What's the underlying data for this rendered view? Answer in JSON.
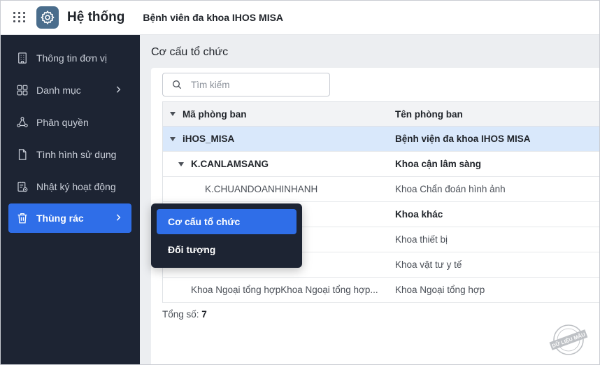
{
  "header": {
    "app_title": "Hệ thống",
    "org_name": "Bệnh viên đa khoa IHOS MISA"
  },
  "sidebar": {
    "items": [
      {
        "label": "Thông tin đơn vị",
        "icon": "building-icon"
      },
      {
        "label": "Danh mục",
        "icon": "category-grid-icon",
        "has_submenu": true
      },
      {
        "label": "Phân quyền",
        "icon": "permission-nodes-icon"
      },
      {
        "label": "Tình hình sử dụng",
        "icon": "document-icon"
      },
      {
        "label": "Nhật ký hoạt động",
        "icon": "activity-log-icon"
      },
      {
        "label": "Thùng rác",
        "icon": "trash-icon",
        "has_submenu": true,
        "active": true
      }
    ]
  },
  "main": {
    "page_title": "Cơ cấu tổ chức",
    "search": {
      "placeholder": "Tìm kiếm",
      "value": ""
    },
    "table": {
      "columns": [
        "Mã phòng ban",
        "Tên phòng ban"
      ],
      "rows": [
        {
          "code": "iHOS_MISA",
          "name": "Bệnh viện đa khoa IHOS MISA",
          "level": 0,
          "expanded": true,
          "bold": true,
          "selected": true
        },
        {
          "code": "K.CANLAMSANG",
          "name": "Khoa cận lâm sàng",
          "level": 1,
          "expanded": true,
          "bold": true
        },
        {
          "code": "K.CHUANDOANHINHANH",
          "name": "Khoa Chẩn đoán hình ảnh",
          "level": 2
        },
        {
          "code": "",
          "name": "Khoa khác",
          "level": 1,
          "bold": true
        },
        {
          "code": "",
          "name": "Khoa thiết bị",
          "level": 2
        },
        {
          "code": "",
          "name": "Khoa vật tư y tế",
          "level": 2
        },
        {
          "code": "Khoa Ngoại tổng hợpKhoa Ngoại tổng hợp...",
          "name": "Khoa Ngoại tổng hợp",
          "level": 1
        }
      ]
    },
    "footer": {
      "total_label": "Tổng số:",
      "total_value": "7"
    }
  },
  "popup_menu": {
    "items": [
      {
        "label": "Cơ cấu tổ chức",
        "active": true
      },
      {
        "label": "Đối tượng",
        "active": false
      }
    ]
  },
  "watermark": {
    "text": "DỮ LIỆU MẪU"
  },
  "colors": {
    "sidebar_bg": "#1d2433",
    "accent": "#2f6ee8",
    "selected_row": "#d9e8fb",
    "main_bg": "#eceef1",
    "logo_bg": "#4a6d8c"
  }
}
